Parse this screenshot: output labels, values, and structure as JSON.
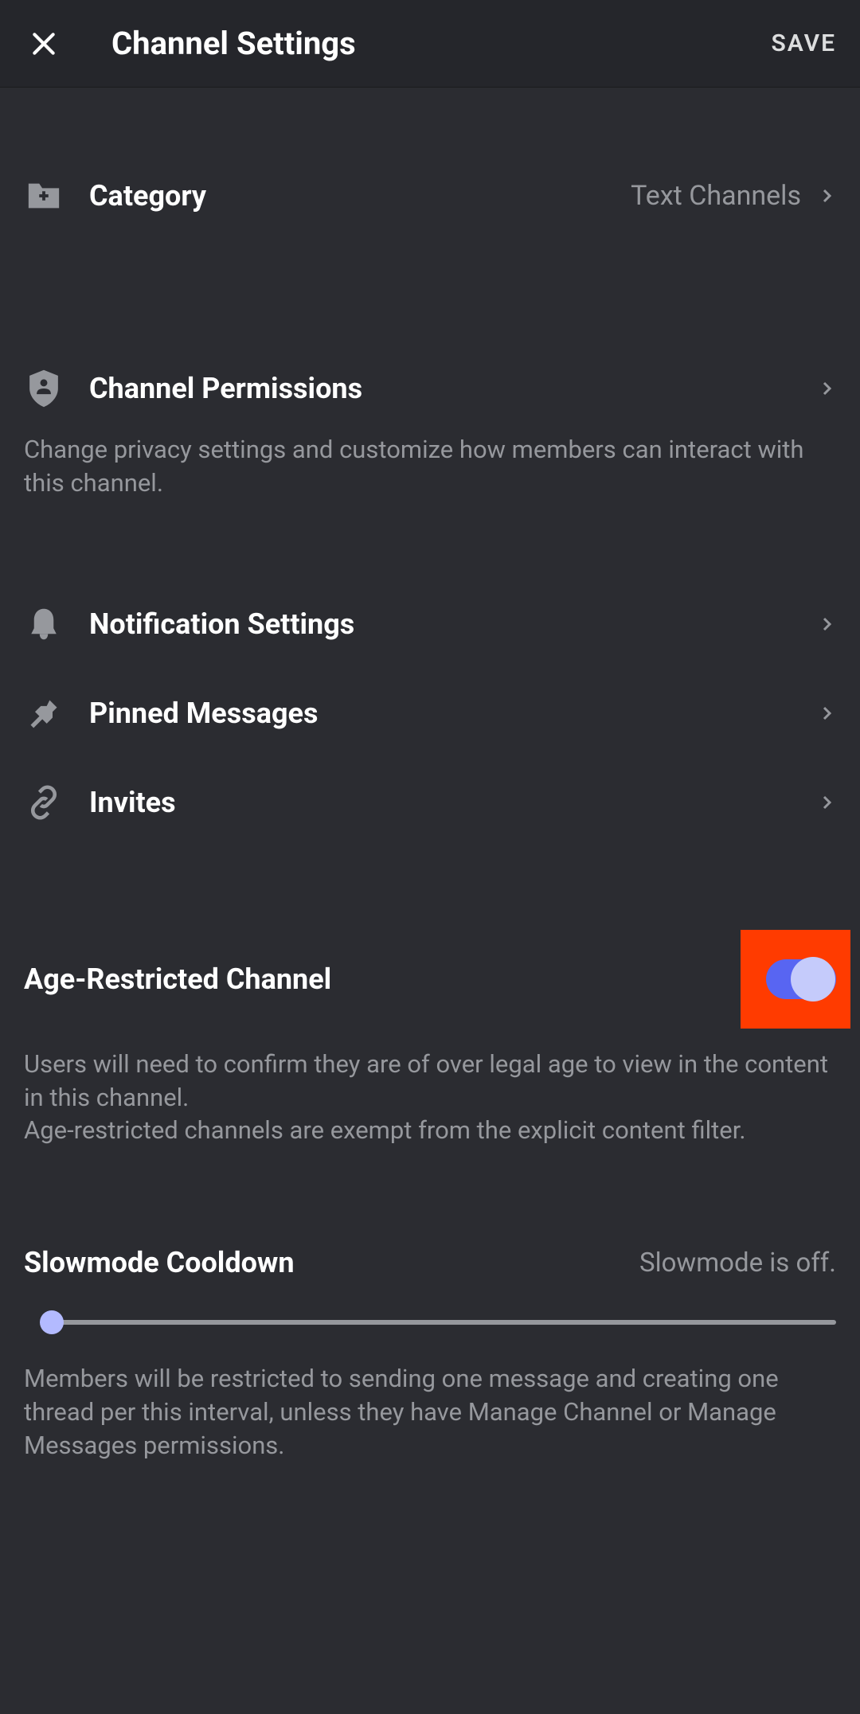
{
  "header": {
    "title": "Channel Settings",
    "save_label": "SAVE"
  },
  "category": {
    "label": "Category",
    "value": "Text Channels"
  },
  "permissions": {
    "label": "Channel Permissions",
    "description": "Change privacy settings and customize how members can interact with this channel."
  },
  "notifications": {
    "label": "Notification Settings"
  },
  "pinned": {
    "label": "Pinned Messages"
  },
  "invites": {
    "label": "Invites"
  },
  "age_restricted": {
    "label": "Age-Restricted Channel",
    "enabled": true,
    "description": "Users will need to confirm they are of over legal age to view in the content in this channel.\nAge-restricted channels are exempt from the explicit content filter."
  },
  "slowmode": {
    "label": "Slowmode Cooldown",
    "status": "Slowmode is off.",
    "value": 0,
    "description": "Members will be restricted to sending one message and creating one thread per this interval, unless they have Manage Channel or Manage Messages permissions."
  }
}
